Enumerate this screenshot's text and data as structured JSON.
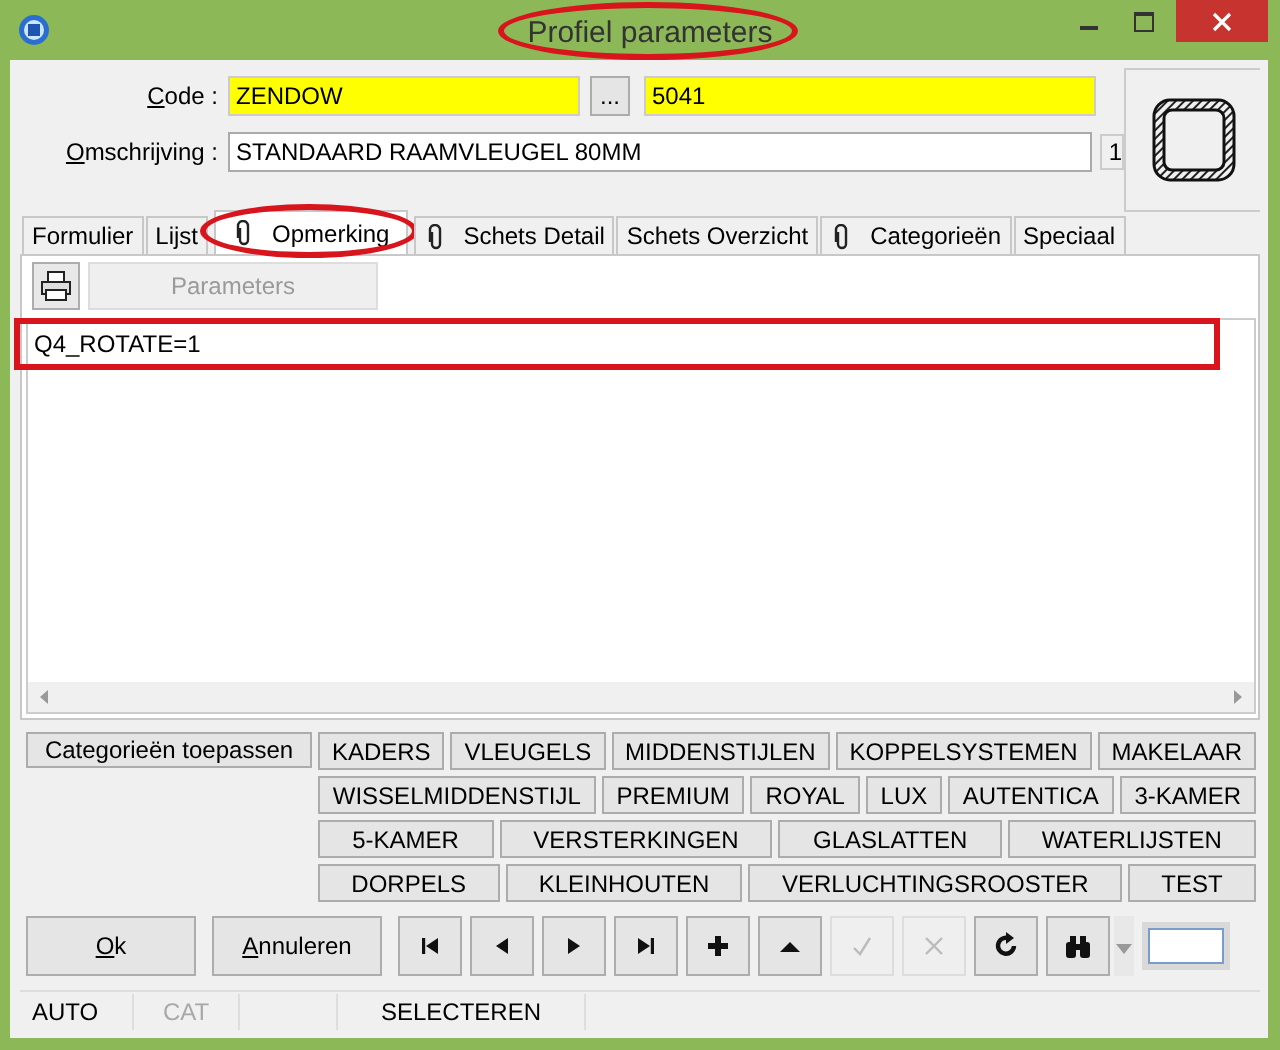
{
  "window": {
    "title": "Profiel parameters",
    "title_highlighted": true
  },
  "code": {
    "label": "Code :",
    "value": "ZENDOW",
    "browse": "...",
    "number": "5041"
  },
  "description": {
    "label": "Omschrijving :",
    "value": "STANDAARD RAAMVLEUGEL 80MM",
    "index": "1"
  },
  "tabs": [
    {
      "label": "Formulier",
      "selected": false,
      "attachment": false,
      "highlighted": false
    },
    {
      "label": "Lijst",
      "selected": false,
      "attachment": false,
      "highlighted": false
    },
    {
      "label": "Opmerking",
      "selected": true,
      "attachment": true,
      "highlighted": true
    },
    {
      "label": "Schets Detail",
      "selected": false,
      "attachment": true,
      "highlighted": false
    },
    {
      "label": "Schets Overzicht",
      "selected": false,
      "attachment": false,
      "highlighted": false
    },
    {
      "label": "Categorieën",
      "selected": false,
      "attachment": true,
      "highlighted": false
    },
    {
      "label": "Speciaal",
      "selected": false,
      "attachment": false,
      "highlighted": false
    }
  ],
  "toolbar": {
    "parameters": "Parameters",
    "parameters_disabled": true
  },
  "memo": {
    "text": "Q4_ROTATE=1",
    "highlighted": true
  },
  "categories": {
    "apply": "Categorieën toepassen",
    "rows": [
      {
        "buttons": [
          "KADERS",
          "VLEUGELS",
          "MIDDENSTIJLEN",
          "KOPPELSYSTEMEN",
          "MAKELAAR"
        ]
      },
      {
        "buttons": [
          "WISSELMIDDENSTIJL",
          "PREMIUM",
          "ROYAL",
          "LUX",
          "AUTENTICA",
          "3-KAMER"
        ]
      },
      {
        "buttons": [
          "5-KAMER",
          "VERSTERKINGEN",
          "GLASLATTEN",
          "WATERLIJSTEN"
        ]
      },
      {
        "buttons": [
          "DORPELS",
          "KLEINHOUTEN",
          "VERLUCHTINGSROOSTER",
          "TEST"
        ]
      }
    ]
  },
  "ok": "Ok",
  "cancel": "Annuleren",
  "nav": [
    {
      "kind": "first",
      "disabled": false
    },
    {
      "kind": "prev",
      "disabled": false
    },
    {
      "kind": "next",
      "disabled": false
    },
    {
      "kind": "last",
      "disabled": false
    },
    {
      "kind": "add",
      "disabled": false
    },
    {
      "kind": "up",
      "disabled": false
    },
    {
      "kind": "confirm",
      "disabled": true
    },
    {
      "kind": "discard",
      "disabled": true
    },
    {
      "kind": "refresh",
      "disabled": false
    },
    {
      "kind": "find",
      "disabled": false
    }
  ],
  "status_bar": [
    {
      "text": "AUTO",
      "disabled": false
    },
    {
      "text": "CAT",
      "disabled": true
    },
    {
      "text": "SELECTEREN",
      "disabled": false
    }
  ]
}
